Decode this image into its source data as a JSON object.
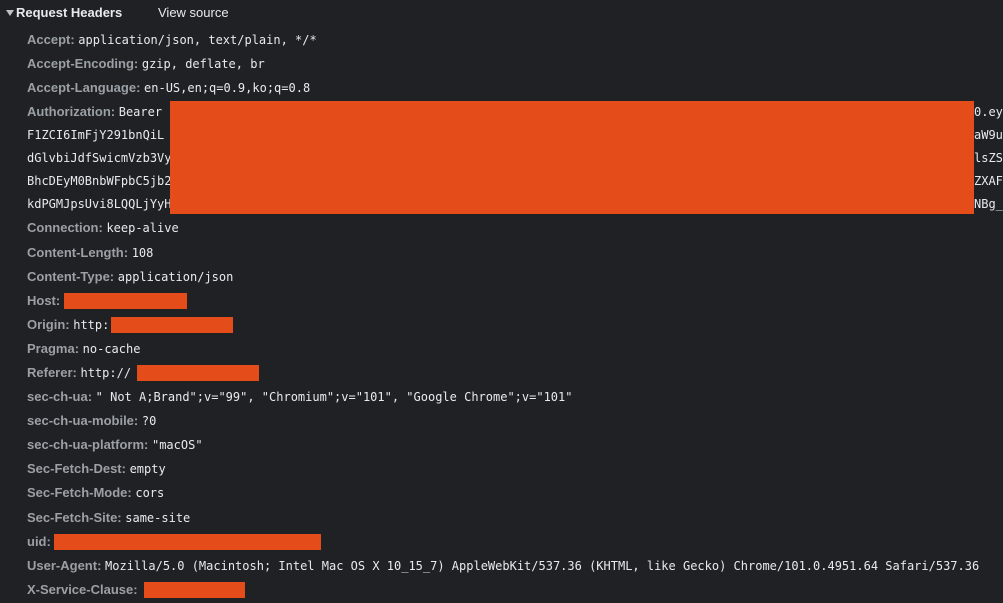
{
  "section": {
    "title": "Request Headers",
    "view_source": "View source"
  },
  "colors": {
    "background": "#202124",
    "header_name": "#9aa0a6",
    "header_value": "#e8eaed",
    "redaction": "#e44d1a"
  },
  "headers": {
    "accept": {
      "name": "Accept:",
      "value": "application/json, text/plain, */*"
    },
    "accept_encoding": {
      "name": "Accept-Encoding:",
      "value": "gzip, deflate, br"
    },
    "accept_language": {
      "name": "Accept-Language:",
      "value": "en-US,en;q=0.9,ko;q=0.8"
    },
    "authorization": {
      "name": "Authorization:",
      "value_prefix": "Bearer",
      "lines_left": [
        "F1ZCI6ImFjY291bnQiL",
        "dGlvbiJdfSwicmVzb3Vy",
        "BhcDEyM0BnbWFpbC5jb2",
        "kdPGMJpsUvi8LQQLjYyH"
      ],
      "lines_right": [
        "0.ey",
        "aW9u",
        "lsZS",
        "ZXAF",
        "NBg_"
      ]
    },
    "connection": {
      "name": "Connection:",
      "value": "keep-alive"
    },
    "content_length": {
      "name": "Content-Length:",
      "value": "108"
    },
    "content_type": {
      "name": "Content-Type:",
      "value": "application/json"
    },
    "host": {
      "name": "Host:",
      "value": ""
    },
    "origin": {
      "name": "Origin:",
      "value": "http:"
    },
    "pragma": {
      "name": "Pragma:",
      "value": "no-cache"
    },
    "referer": {
      "name": "Referer:",
      "value": "http://"
    },
    "sec_ch_ua": {
      "name": "sec-ch-ua:",
      "value": "\" Not A;Brand\";v=\"99\", \"Chromium\";v=\"101\", \"Google Chrome\";v=\"101\""
    },
    "sec_ch_ua_mobile": {
      "name": "sec-ch-ua-mobile:",
      "value": "?0"
    },
    "sec_ch_ua_platform": {
      "name": "sec-ch-ua-platform:",
      "value": "\"macOS\""
    },
    "sec_fetch_dest": {
      "name": "Sec-Fetch-Dest:",
      "value": "empty"
    },
    "sec_fetch_mode": {
      "name": "Sec-Fetch-Mode:",
      "value": "cors"
    },
    "sec_fetch_site": {
      "name": "Sec-Fetch-Site:",
      "value": "same-site"
    },
    "uid": {
      "name": "uid:",
      "value": ""
    },
    "user_agent": {
      "name": "User-Agent:",
      "value": "Mozilla/5.0 (Macintosh; Intel Mac OS X 10_15_7) AppleWebKit/537.36 (KHTML, like Gecko) Chrome/101.0.4951.64 Safari/537.36"
    },
    "x_service_clause": {
      "name": "X-Service-Clause:",
      "value": ""
    }
  }
}
